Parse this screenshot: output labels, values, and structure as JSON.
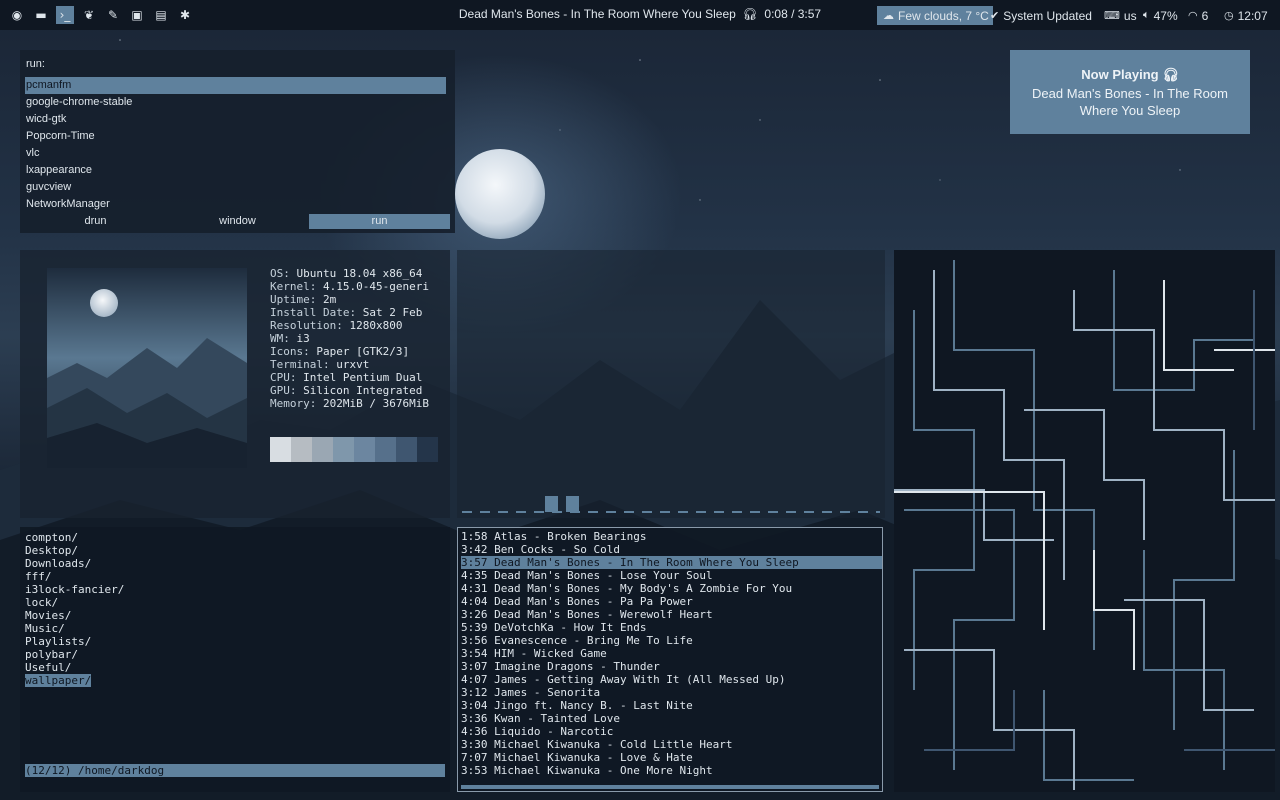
{
  "topbar": {
    "workspace_icons": [
      "chrome-icon",
      "folder-icon",
      "terminal-icon",
      "leaf-icon",
      "brush-icon",
      "image-icon",
      "film-icon",
      "wrench-icon"
    ],
    "workspace_glyphs": [
      "◉",
      "▬",
      "›_",
      "❦",
      "✎",
      "▣",
      "▤",
      "✱"
    ],
    "active_workspace": 2,
    "now_playing": "Dead Man's Bones - In The Room Where You Sleep",
    "progress": "0:08 / 3:57",
    "weather": "Few clouds, 7 °C",
    "update": "System Updated",
    "keyboard": "us",
    "volume": "47%",
    "wifi": "6",
    "clock": "12:07"
  },
  "rofi": {
    "prompt": "run:",
    "items": [
      "pcmanfm",
      "google-chrome-stable",
      "wicd-gtk",
      "Popcorn-Time",
      "vlc",
      "lxappearance",
      "guvcview",
      "NetworkManager"
    ],
    "selected": 0,
    "modes": [
      "drun",
      "window",
      "run"
    ],
    "active_mode": 2
  },
  "notification": {
    "title": "Now Playing",
    "body": "Dead Man's Bones - In The Room Where You Sleep"
  },
  "neofetch": {
    "lines": [
      {
        "k": "OS:",
        "v": "Ubuntu 18.04 x86_64"
      },
      {
        "k": "Kernel:",
        "v": "4.15.0-45-generi"
      },
      {
        "k": "Uptime:",
        "v": "2m"
      },
      {
        "k": "Install Date:",
        "v": "Sat 2 Feb"
      },
      {
        "k": "Resolution:",
        "v": "1280x800"
      },
      {
        "k": "WM:",
        "v": "i3"
      },
      {
        "k": "Icons:",
        "v": "Paper [GTK2/3]"
      },
      {
        "k": "Terminal:",
        "v": "urxvt"
      },
      {
        "k": "CPU:",
        "v": "Intel Pentium Dual"
      },
      {
        "k": "GPU:",
        "v": "Silicon Integrated"
      },
      {
        "k": "Memory:",
        "v": "202MiB / 3676MiB"
      }
    ],
    "colors": [
      "#d8dde2",
      "#b6bcc2",
      "#9aa7b3",
      "#7f97ab",
      "#6c86a0",
      "#56708b",
      "#3f5670",
      "#24354a"
    ]
  },
  "ranger": {
    "entries": [
      "compton/",
      "Desktop/",
      "Downloads/",
      "fff/",
      "i3lock-fancier/",
      "lock/",
      "Movies/",
      "Music/",
      "Playlists/",
      "polybar/",
      "Useful/",
      "wallpaper/"
    ],
    "selected": 11,
    "status": "(12/12) /home/darkdog"
  },
  "playlist": {
    "tracks": [
      {
        "t": "1:58",
        "n": "Atlas - Broken Bearings"
      },
      {
        "t": "3:42",
        "n": "Ben Cocks - So Cold"
      },
      {
        "t": "3:57",
        "n": "Dead Man's Bones - In The Room Where You Sleep"
      },
      {
        "t": "4:35",
        "n": "Dead Man's Bones - Lose Your Soul"
      },
      {
        "t": "4:31",
        "n": "Dead Man's Bones - My Body's A Zombie For You"
      },
      {
        "t": "4:04",
        "n": "Dead Man's Bones - Pa Pa Power"
      },
      {
        "t": "3:26",
        "n": "Dead Man's Bones - Werewolf Heart"
      },
      {
        "t": "5:39",
        "n": "DeVotchKa - How It Ends"
      },
      {
        "t": "3:56",
        "n": "Evanescence - Bring Me To Life"
      },
      {
        "t": "3:54",
        "n": "HIM - Wicked Game"
      },
      {
        "t": "3:07",
        "n": "Imagine Dragons - Thunder"
      },
      {
        "t": "4:07",
        "n": "James - Getting Away With It (All Messed Up)"
      },
      {
        "t": "3:12",
        "n": "James - Senorita"
      },
      {
        "t": "3:04",
        "n": "Jingo ft. Nancy B. - Last Nite"
      },
      {
        "t": "3:36",
        "n": "Kwan - Tainted Love"
      },
      {
        "t": "4:36",
        "n": "Liquido - Narcotic"
      },
      {
        "t": "3:30",
        "n": "Michael Kiwanuka - Cold Little Heart"
      },
      {
        "t": "7:07",
        "n": "Michael Kiwanuka - Love & Hate"
      },
      {
        "t": "3:53",
        "n": "Michael Kiwanuka - One More Night"
      }
    ],
    "selected": 2
  },
  "theme": {
    "accent": "#5f819d",
    "bar_bg": "#0f1722"
  }
}
